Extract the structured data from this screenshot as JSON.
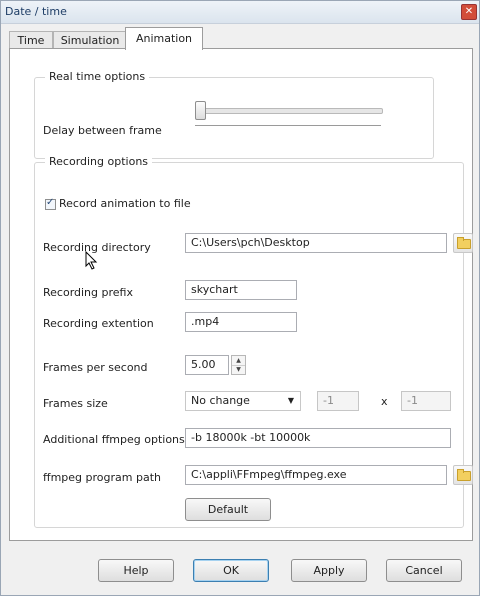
{
  "window": {
    "title": "Date / time",
    "close_glyph": "✕"
  },
  "tabs": [
    {
      "label": "Time"
    },
    {
      "label": "Simulation"
    },
    {
      "label": "Animation"
    }
  ],
  "realtime": {
    "group_title": "Real time options",
    "delay_label": "Delay between frame",
    "delay_value": 0
  },
  "recording": {
    "group_title": "Recording options",
    "record_checkbox_label": "Record animation to file",
    "record_checked": true,
    "directory_label": "Recording directory",
    "directory_value": "C:\\Users\\pch\\Desktop",
    "prefix_label": "Recording prefix",
    "prefix_value": "skychart",
    "extension_label": "Recording extention",
    "extension_value": ".mp4",
    "fps_label": "Frames per second",
    "fps_value": "5.00",
    "frames_size_label": "Frames size",
    "frames_size_value": "No change",
    "frames_width": "-1",
    "frames_height": "-1",
    "frames_sep": "x",
    "ffmpeg_options_label": "Additional ffmpeg options",
    "ffmpeg_options_value": "-b 18000k -bt 10000k",
    "ffmpeg_path_label": "ffmpeg program path",
    "ffmpeg_path_value": "C:\\appli\\FFmpeg\\ffmpeg.exe",
    "default_button": "Default"
  },
  "footer": {
    "help": "Help",
    "ok": "OK",
    "apply": "Apply",
    "cancel": "Cancel"
  },
  "icons": {
    "folder": "folder-icon",
    "checkmark": "✓",
    "dropdown": "▼",
    "spin_up": "▲",
    "spin_down": "▼"
  },
  "colors": {
    "window_bg": "#f0f0f0",
    "panel_bg": "#ffffff",
    "accent_border": "#3c7fb1",
    "folder": "#f2cf5f"
  }
}
